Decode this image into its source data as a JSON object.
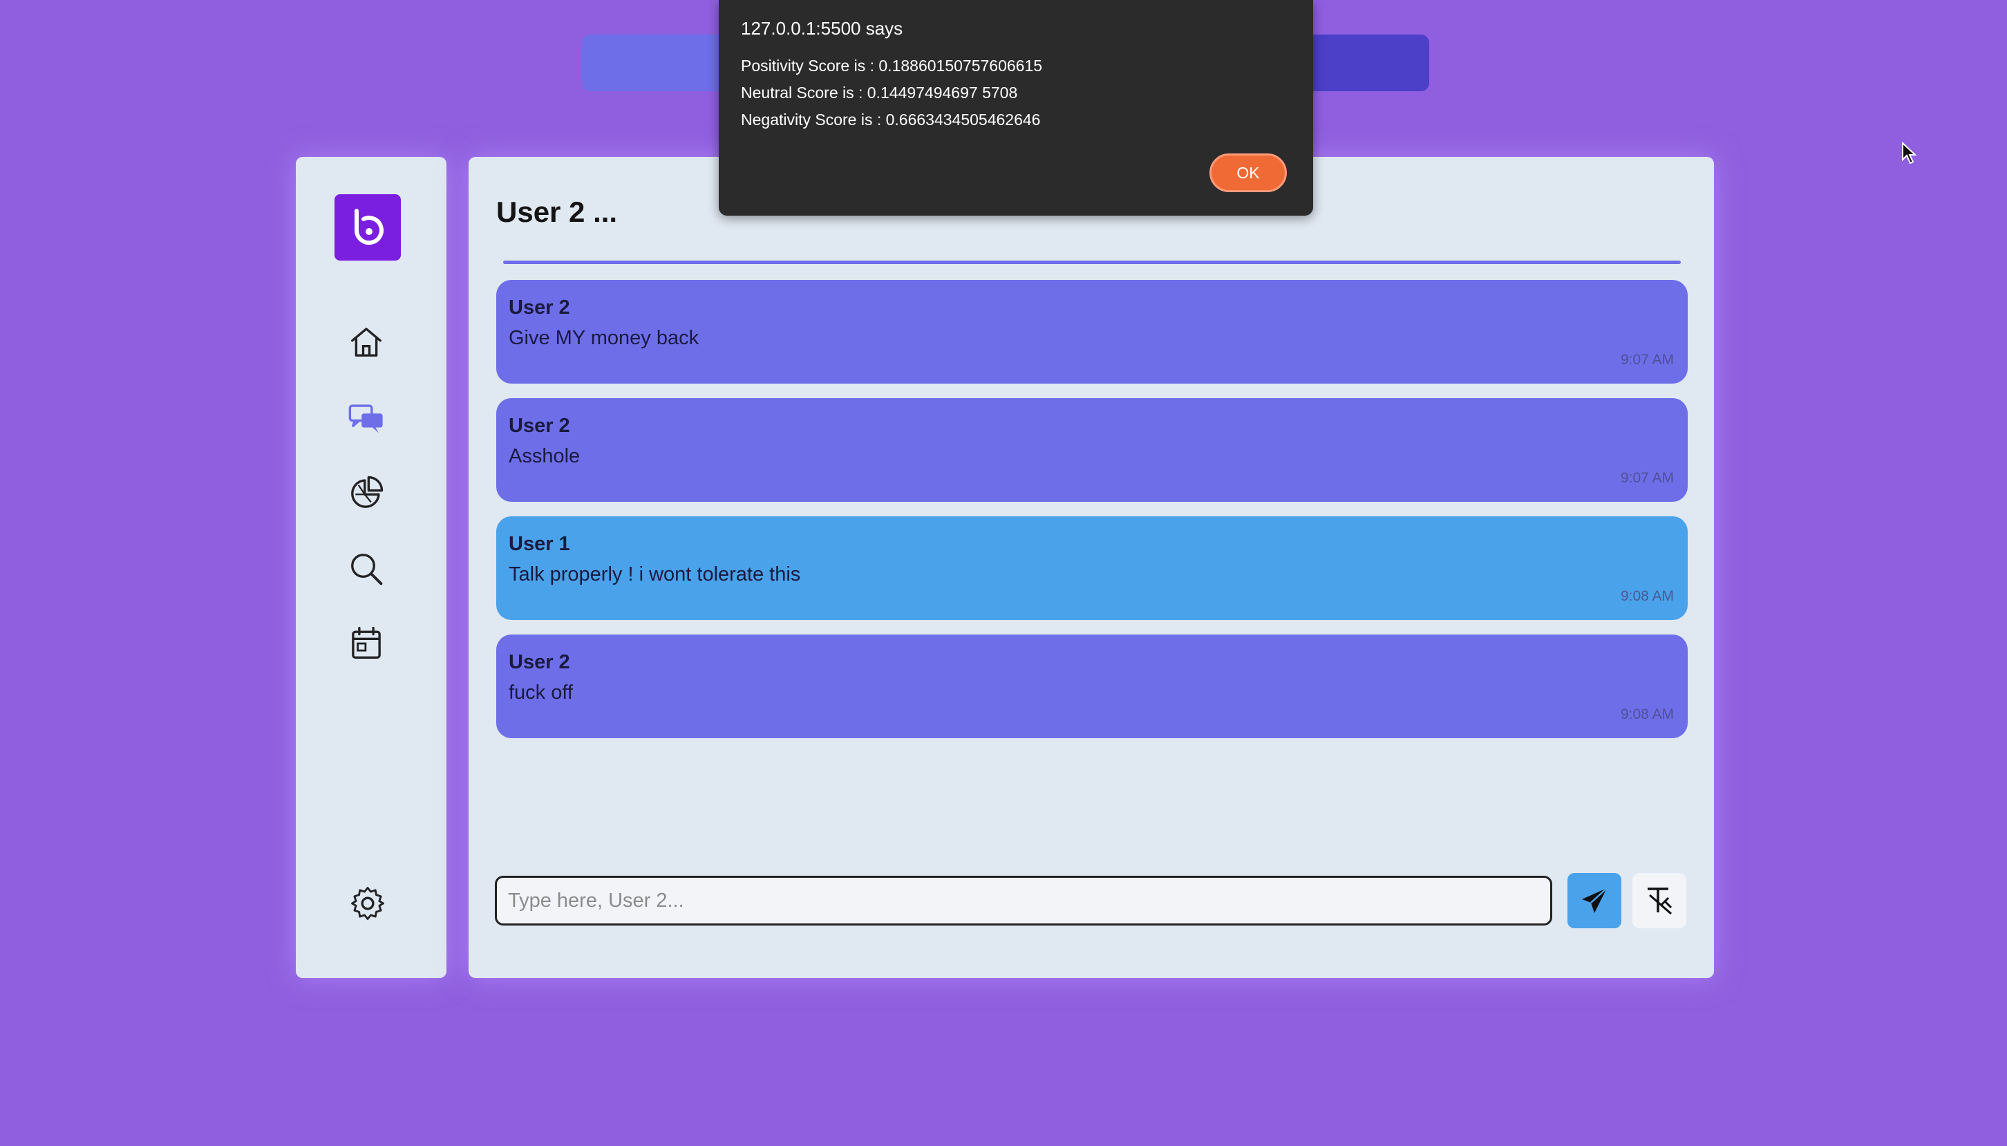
{
  "chat": {
    "title": "User 2 ...",
    "messages": [
      {
        "sender": "User 2",
        "text": "Give MY money back",
        "time": "9:07 AM",
        "color": "#6d6ee8"
      },
      {
        "sender": "User 2",
        "text": "Asshole",
        "time": "9:07 AM",
        "color": "#6d6ee8"
      },
      {
        "sender": "User 1",
        "text": "Talk properly ! i wont tolerate this",
        "time": "9:08 AM",
        "color": "#4aa2ea"
      },
      {
        "sender": "User 2",
        "text": "fuck off",
        "time": "9:08 AM",
        "color": "#6d6ee8"
      }
    ],
    "input": {
      "placeholder": "Type here, User 2...",
      "value": ""
    }
  },
  "dialog": {
    "title": "127.0.0.1:5500 says",
    "lines": [
      "Positivity Score is : 0.18860150757606615",
      "Neutral Score is : 0.14497494697 5708",
      "Negativity Score is : 0.6663434505462646"
    ],
    "ok_label": "OK"
  },
  "icons": {
    "logo": "logo-b-icon",
    "nav": [
      "home-icon",
      "chat-icon",
      "pie-chart-icon",
      "search-icon",
      "calendar-icon"
    ],
    "settings": "gear-icon",
    "send": "send-icon",
    "clear": "clear-format-icon"
  },
  "colors": {
    "background": "#8f5fdf",
    "panel": "#e0e8f2",
    "accent": "#6d6ee8",
    "self_message": "#4aa2ea",
    "logo": "#7a1ee0",
    "dialog_bg": "#2b2b2b",
    "ok_button": "#f06a35"
  }
}
